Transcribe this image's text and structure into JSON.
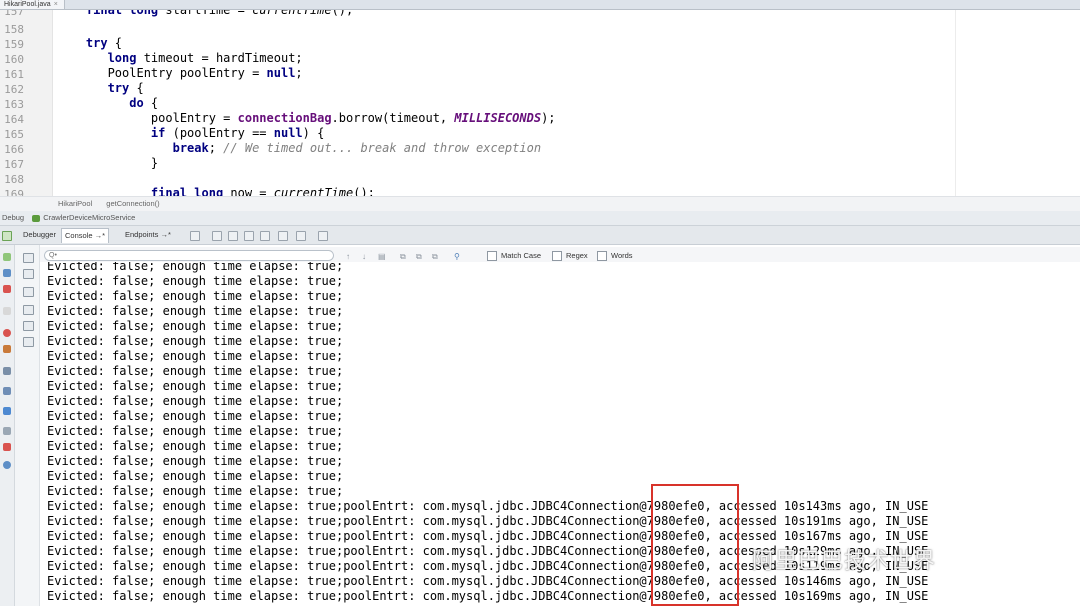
{
  "editor_tab": {
    "filename": "HikariPool.java",
    "close": "×"
  },
  "editor": {
    "lines": [
      {
        "no": "157",
        "text": "    final long startTime = currentTime();"
      },
      {
        "no": "158",
        "text": ""
      },
      {
        "no": "159",
        "text": "    try {"
      },
      {
        "no": "160",
        "text": "       long timeout = hardTimeout;"
      },
      {
        "no": "161",
        "text": "       PoolEntry poolEntry = null;"
      },
      {
        "no": "162",
        "text": "       try {"
      },
      {
        "no": "163",
        "text": "          do {"
      },
      {
        "no": "164",
        "text": "             poolEntry = connectionBag.borrow(timeout, MILLISECONDS);"
      },
      {
        "no": "165",
        "text": "             if (poolEntry == null) {"
      },
      {
        "no": "166",
        "text": "                break; // We timed out... break and throw exception"
      },
      {
        "no": "167",
        "text": "             }"
      },
      {
        "no": "168",
        "text": ""
      },
      {
        "no": "169",
        "text": "             final long now = currentTime();"
      }
    ]
  },
  "breadcrumb": {
    "class": "HikariPool",
    "method": "getConnection()"
  },
  "debug_panel": {
    "label": "Debug",
    "config": "CrawlerDeviceMicroService",
    "tabs": {
      "debugger": "Debugger",
      "console": "Console",
      "console_arrow": "→*",
      "endpoints": "Endpoints",
      "endpoints_arrow": "→*"
    }
  },
  "find_bar": {
    "placeholder": "Q•",
    "match_case": "Match Case",
    "regex": "Regex",
    "words": "Words"
  },
  "console": {
    "lines": [
      "Evicted: false; enough time elapse: true;",
      "Evicted: false; enough time elapse: true;",
      "Evicted: false; enough time elapse: true;",
      "Evicted: false; enough time elapse: true;",
      "Evicted: false; enough time elapse: true;",
      "Evicted: false; enough time elapse: true;",
      "Evicted: false; enough time elapse: true;",
      "Evicted: false; enough time elapse: true;",
      "Evicted: false; enough time elapse: true;",
      "Evicted: false; enough time elapse: true;",
      "Evicted: false; enough time elapse: true;",
      "Evicted: false; enough time elapse: true;",
      "Evicted: false; enough time elapse: true;",
      "Evicted: false; enough time elapse: true;",
      "Evicted: false; enough time elapse: true;",
      "Evicted: false; enough time elapse: true;",
      "Evicted: false; enough time elapse: true;poolEntrt: com.mysql.jdbc.JDBC4Connection@7980efe0, accessed 10s143ms ago, IN_USE",
      "Evicted: false; enough time elapse: true;poolEntrt: com.mysql.jdbc.JDBC4Connection@7980efe0, accessed 10s191ms ago, IN_USE",
      "Evicted: false; enough time elapse: true;poolEntrt: com.mysql.jdbc.JDBC4Connection@7980efe0, accessed 10s167ms ago, IN_USE",
      "Evicted: false; enough time elapse: true;poolEntrt: com.mysql.jdbc.JDBC4Connection@7980efe0, accessed 10s129ms ago, IN_USE",
      "Evicted: false; enough time elapse: true;poolEntrt: com.mysql.jdbc.JDBC4Connection@7980efe0, accessed 10s119ms ago, IN_USE",
      "Evicted: false; enough time elapse: true;poolEntrt: com.mysql.jdbc.JDBC4Connection@7980efe0, accessed 10s146ms ago, IN_USE",
      "Evicted: false; enough time elapse: true;poolEntrt: com.mysql.jdbc.JDBC4Connection@7980efe0, accessed 10s169ms ago, IN_USE"
    ]
  },
  "watermark": "阿里巴巴技术世界",
  "colors": {
    "highlight": "#d8332a",
    "keyword": "#000080",
    "field": "#660e7a",
    "comment": "#808080"
  }
}
